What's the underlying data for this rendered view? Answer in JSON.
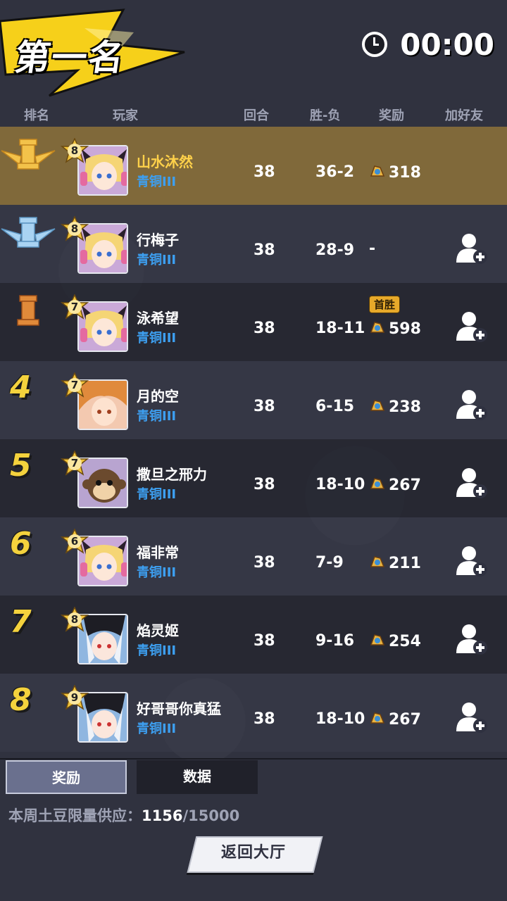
{
  "header": {
    "title": "第一名",
    "timer": "00:00"
  },
  "columns": {
    "rank": "排名",
    "player": "玩家",
    "rounds": "回合",
    "win_loss": "胜-负",
    "reward": "奖励",
    "add_friend": "加好友"
  },
  "colors": {
    "gold_row": "#80693a",
    "rank_number": "#f4d23d",
    "tier_blue": "#3d9ff0"
  },
  "rows": [
    {
      "rank": "1",
      "rank_icon": "gold-rook-wings-icon",
      "level": "8",
      "name": "山水沐然",
      "tier": "青铜III",
      "rounds": "38",
      "wl": "36-2",
      "reward": "318",
      "badge": "",
      "avatar": "blonde-girl-avatar"
    },
    {
      "rank": "2",
      "rank_icon": "silver-rook-wings-icon",
      "level": "8",
      "name": "行梅子",
      "tier": "青铜III",
      "rounds": "38",
      "wl": "28-9",
      "reward": "-",
      "badge": "",
      "avatar": "blonde-girl-avatar"
    },
    {
      "rank": "3",
      "rank_icon": "bronze-rook-icon",
      "level": "7",
      "name": "泳希望",
      "tier": "青铜III",
      "rounds": "38",
      "wl": "18-11",
      "reward": "598",
      "badge": "首胜",
      "avatar": "blonde-girl-avatar"
    },
    {
      "rank": "4",
      "level": "7",
      "name": "月的空",
      "tier": "青铜III",
      "rounds": "38",
      "wl": "6-15",
      "reward": "238",
      "badge": "",
      "avatar": "red-hair-girl-avatar"
    },
    {
      "rank": "5",
      "level": "7",
      "name": "撒旦之邢力",
      "tier": "青铜III",
      "rounds": "38",
      "wl": "18-10",
      "reward": "267",
      "badge": "",
      "avatar": "monkey-avatar"
    },
    {
      "rank": "6",
      "level": "6",
      "name": "福非常",
      "tier": "青铜III",
      "rounds": "38",
      "wl": "7-9",
      "reward": "211",
      "badge": "",
      "avatar": "blonde-girl-avatar"
    },
    {
      "rank": "7",
      "level": "8",
      "name": "焰灵姬",
      "tier": "青铜III",
      "rounds": "38",
      "wl": "9-16",
      "reward": "254",
      "badge": "",
      "avatar": "white-hair-girl-avatar"
    },
    {
      "rank": "8",
      "level": "9",
      "name": "好哥哥你真猛",
      "tier": "青铜III",
      "rounds": "38",
      "wl": "18-10",
      "reward": "267",
      "badge": "",
      "avatar": "white-hair-girl-avatar"
    }
  ],
  "tabs": {
    "rewards": "奖励",
    "stats": "数据"
  },
  "supply": {
    "label": "本周土豆限量供应：",
    "current": "1156",
    "total": "/15000"
  },
  "back_button": "返回大厅"
}
